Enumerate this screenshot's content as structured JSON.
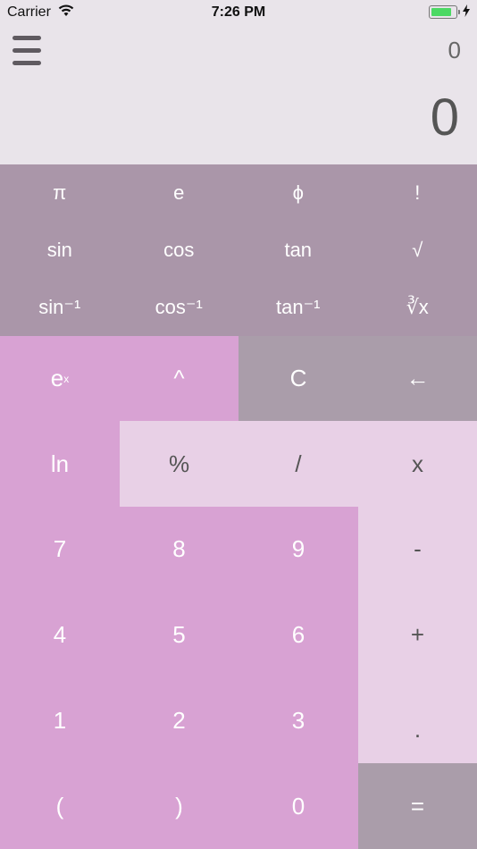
{
  "status_bar": {
    "carrier": "Carrier",
    "time": "7:26 PM",
    "battery_level": 0.85,
    "battery_color": "#4cd964"
  },
  "display": {
    "expression": "0",
    "result": "0",
    "menu_icon": "hamburger-menu-icon"
  },
  "scientific_keys": [
    [
      "π",
      "e",
      "ϕ",
      "!"
    ],
    [
      "sin",
      "cos",
      "tan",
      "√"
    ],
    [
      "sin⁻¹",
      "cos⁻¹",
      "tan⁻¹",
      "∛x"
    ]
  ],
  "keys": {
    "exp_base": "e",
    "exp_sup": "x",
    "power": "^",
    "clear": "C",
    "backspace": "←",
    "ln": "ln",
    "percent": "%",
    "divide": "/",
    "multiply": "x",
    "seven": "7",
    "eight": "8",
    "nine": "9",
    "minus": "-",
    "four": "4",
    "five": "5",
    "six": "6",
    "plus": "+",
    "one": "1",
    "two": "2",
    "three": "3",
    "dot": ".",
    "open_paren": "(",
    "close_paren": ")",
    "zero": "0",
    "equals": "="
  },
  "colors": {
    "background": "#e9e4ea",
    "sci_panel": "#aa96a9",
    "pink_key": "#d8a2d3",
    "light_key": "#e8d0e6",
    "gray_key": "#aa9daa"
  }
}
